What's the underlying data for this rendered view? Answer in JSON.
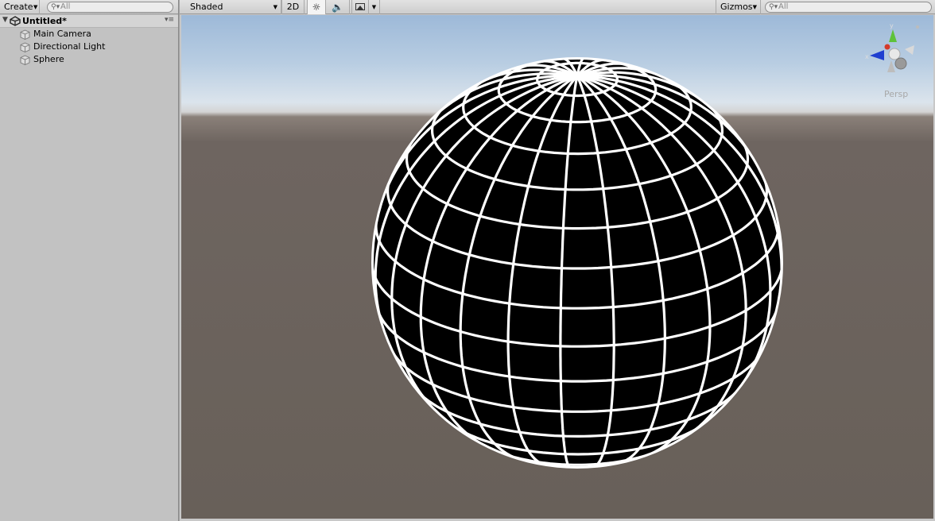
{
  "hierarchy": {
    "create_label": "Create",
    "search_placeholder": "All",
    "scene_name": "Untitled*",
    "items": [
      {
        "label": "Main Camera",
        "icon": "cube-icon"
      },
      {
        "label": "Directional Light",
        "icon": "cube-icon"
      },
      {
        "label": "Sphere",
        "icon": "cube-icon"
      }
    ]
  },
  "scene_view": {
    "shading_mode": "Shaded",
    "two_d_label": "2D",
    "gizmos_label": "Gizmos",
    "search_placeholder": "All",
    "projection_label": "Persp",
    "gizmo_axis_y": "y",
    "gizmo_axis_x": "x",
    "icons": [
      "sun-icon",
      "speaker-icon",
      "image-icon"
    ]
  },
  "colors": {
    "sky_top": "#9db9d8",
    "ground": "#686059",
    "panel_bg": "#c2c2c2",
    "axis_y": "#5ec23a",
    "axis_x": "#1f3fd0"
  }
}
